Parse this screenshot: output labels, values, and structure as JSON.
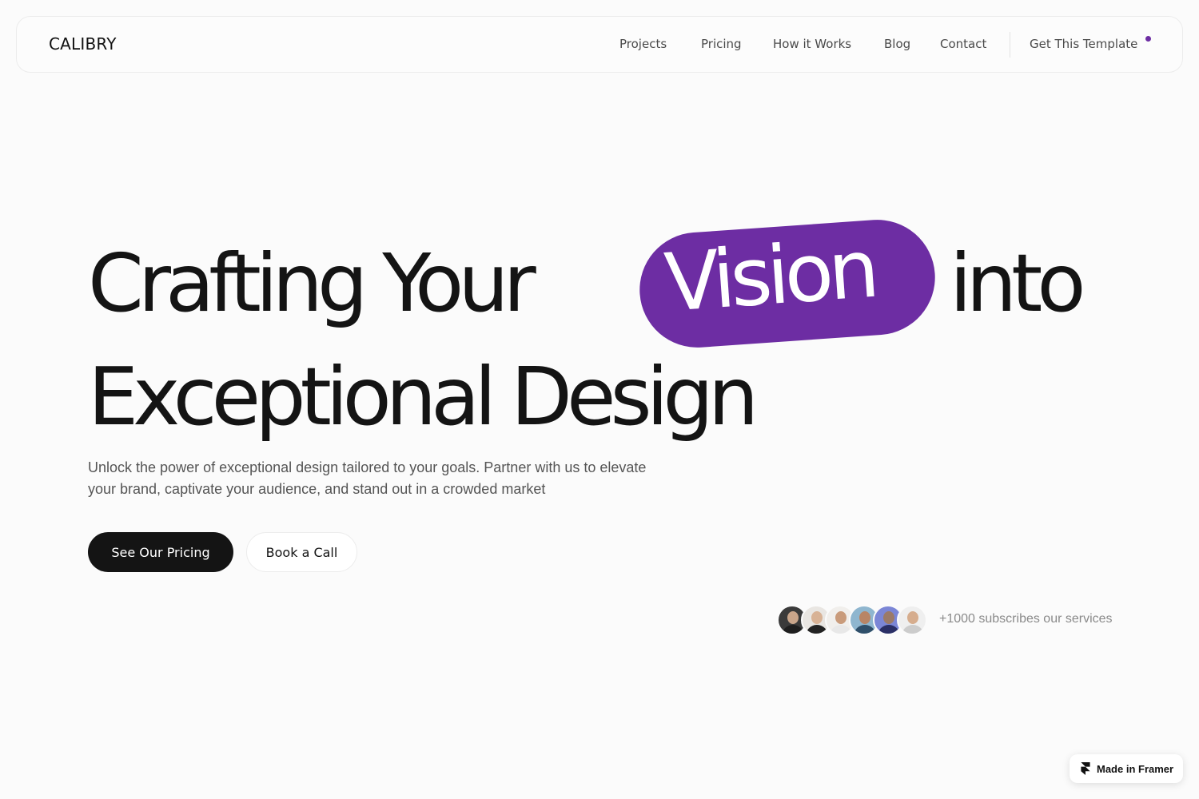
{
  "brand": {
    "logo": "CALIBRY",
    "accent_color": "#6d2da3"
  },
  "nav": {
    "links": [
      "Projects",
      "Pricing",
      "How it Works",
      "Blog",
      "Contact"
    ],
    "cta": "Get This Template"
  },
  "hero": {
    "line1_start": "Crafting Your",
    "highlight": "Vision",
    "line1_end": "into",
    "line2": "Exceptional Design",
    "subtitle": "Unlock the power of exceptional design tailored to your goals. Partner with us to elevate your brand, captivate your audience, and stand out in a crowded market",
    "primary_button": "See Our Pricing",
    "secondary_button": "Book a Call"
  },
  "social_proof": {
    "avatar_count": 6,
    "text": "+1000 subscribes our services"
  },
  "badge": {
    "label": "Made in Framer",
    "icon": "framer-icon"
  }
}
